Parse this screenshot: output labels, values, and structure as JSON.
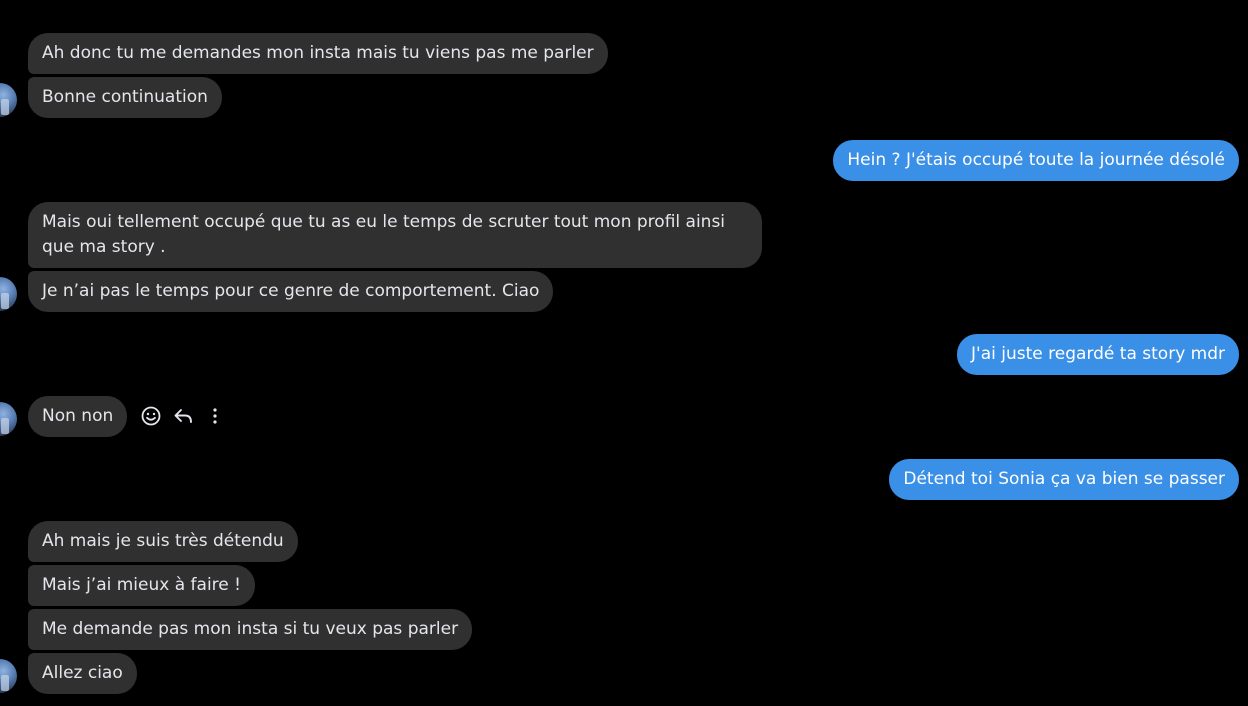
{
  "conversation": {
    "messages": [
      {
        "direction": "incoming",
        "text": "Ah donc tu me demandes mon insta mais tu viens pas me parler"
      },
      {
        "direction": "incoming",
        "text": "Bonne continuation"
      },
      {
        "direction": "outgoing",
        "text": "Hein ? J'étais occupé toute la journée désolé"
      },
      {
        "direction": "incoming",
        "text": "Mais oui tellement occupé que tu as eu le temps de scruter tout mon profil ainsi que ma story ."
      },
      {
        "direction": "incoming",
        "text": "Je n’ai pas le temps pour ce genre de comportement. Ciao"
      },
      {
        "direction": "outgoing",
        "text": "J'ai juste regardé ta story mdr"
      },
      {
        "direction": "incoming",
        "text": "Non non"
      },
      {
        "direction": "outgoing",
        "text": "Détend toi Sonia ça va bien se passer"
      },
      {
        "direction": "incoming",
        "text": "Ah mais je suis très détendu"
      },
      {
        "direction": "incoming",
        "text": "Mais j’ai mieux à faire !"
      },
      {
        "direction": "incoming",
        "text": "Me demande pas mon insta si tu veux pas parler"
      },
      {
        "direction": "incoming",
        "text": "Allez ciao"
      }
    ]
  },
  "hover_actions": {
    "icons": [
      "smiley-icon",
      "reply-icon",
      "more-options-icon"
    ]
  },
  "colors": {
    "background": "#000000",
    "incoming_bubble": "#303030",
    "outgoing_bubble": "#3a8fe6",
    "text": "#e4e6eb"
  }
}
